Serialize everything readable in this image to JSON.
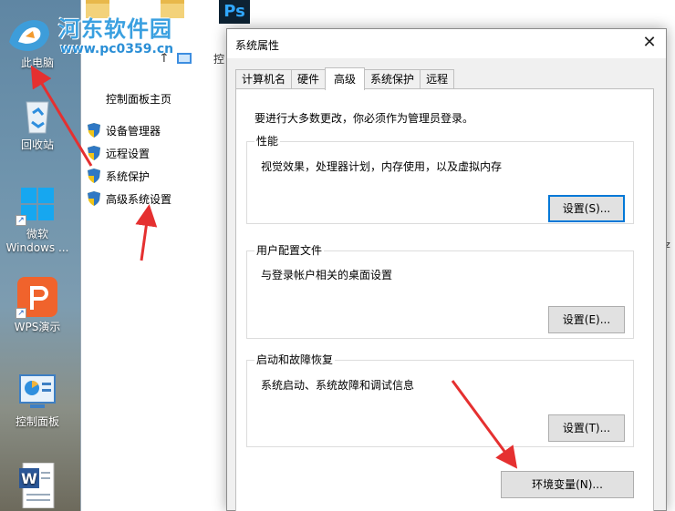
{
  "watermark": {
    "title": "河东软件园",
    "url": "www.pc0359.cn"
  },
  "desktop": {
    "icons": [
      {
        "label": "此电脑",
        "icon": "computer-icon"
      },
      {
        "label": "回收站",
        "icon": "recycle-bin-icon"
      },
      {
        "label": "微软\nWindows ...",
        "icon": "windows-logo-icon"
      },
      {
        "label": "WPS演示",
        "icon": "wps-presentation-icon"
      },
      {
        "label": "控制面板",
        "icon": "control-panel-icon"
      },
      {
        "label": "",
        "icon": "word-document-icon"
      }
    ]
  },
  "explorer": {
    "address_text": "控",
    "edge_text": "dz",
    "home_link": "控制面板主页",
    "nav_items": [
      {
        "label": "设备管理器",
        "icon": "shield-icon"
      },
      {
        "label": "远程设置",
        "icon": "shield-icon"
      },
      {
        "label": "系统保护",
        "icon": "shield-icon"
      },
      {
        "label": "高级系统设置",
        "icon": "shield-icon"
      }
    ]
  },
  "dialog": {
    "title": "系统属性",
    "close_glyph": "✕",
    "tabs": [
      "计算机名",
      "硬件",
      "高级",
      "系统保护",
      "远程"
    ],
    "active_tab": "高级",
    "admin_note": "要进行大多数更改，你必须作为管理员登录。",
    "performance": {
      "title": "性能",
      "desc": "视觉效果，处理器计划，内存使用，以及虚拟内存",
      "button": "设置(S)..."
    },
    "user_profiles": {
      "title": "用户配置文件",
      "desc": "与登录帐户相关的桌面设置",
      "button": "设置(E)..."
    },
    "startup_recovery": {
      "title": "启动和故障恢复",
      "desc": "系统启动、系统故障和调试信息",
      "button": "设置(T)..."
    },
    "env_button": "环境变量(N)..."
  },
  "colors": {
    "arrow": "#e53030",
    "accent": "#0078d7",
    "ps_blue": "#31a8ff"
  }
}
